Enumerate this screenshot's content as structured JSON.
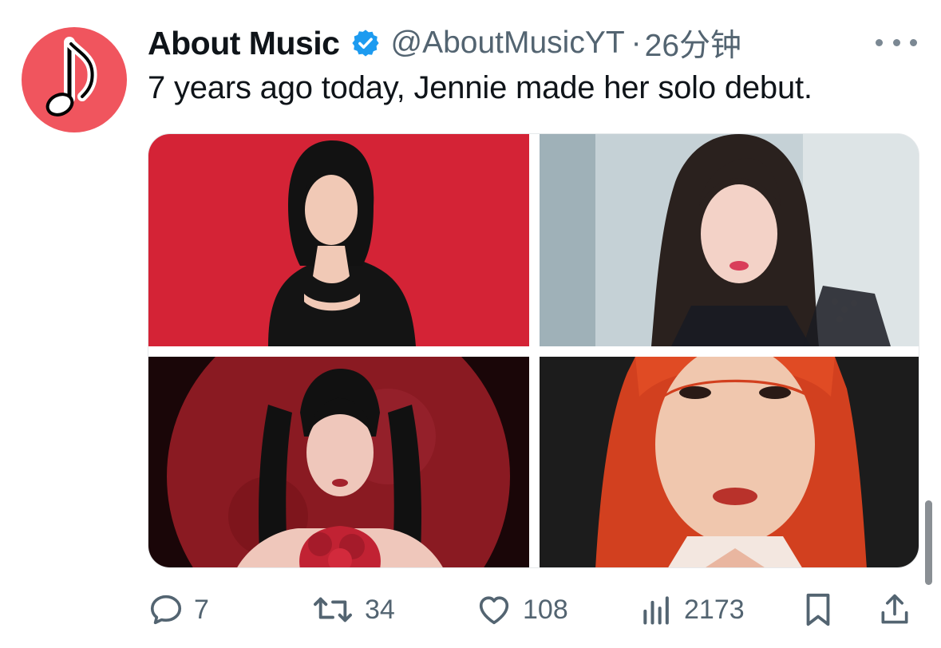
{
  "tweet": {
    "author_name": "About Music",
    "handle": "@AboutMusicYT",
    "separator": "·",
    "time": "26分钟",
    "text": "7 years ago today, Jennie made her solo debut.",
    "avatar_icon": "music-note-icon",
    "verified_icon": "verified-badge-icon",
    "more_icon": "more-options-icon",
    "accent_color": "#1d9bf0",
    "avatar_color": "#f0555e"
  },
  "media": [
    {
      "icon": "photo",
      "background": "#d42336"
    },
    {
      "icon": "photo",
      "background": "#b9c6cc"
    },
    {
      "icon": "photo",
      "background": "#6e0f16"
    },
    {
      "icon": "photo",
      "background": "#1c1c1c"
    }
  ],
  "actions": {
    "reply_count": "7",
    "retweet_count": "34",
    "like_count": "108",
    "views_count": "2173"
  }
}
